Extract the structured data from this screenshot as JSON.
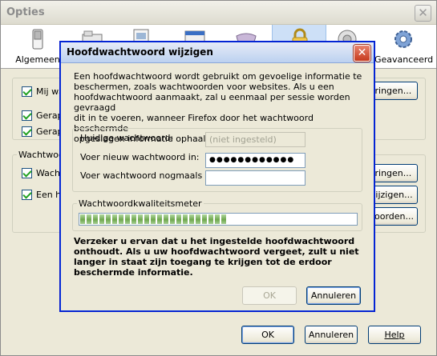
{
  "options_window": {
    "title": "Opties",
    "close_glyph": "✕",
    "toolbar": [
      {
        "label": "Algemeen",
        "icon": "switch-icon"
      },
      {
        "label": "",
        "icon": "tabs-icon"
      },
      {
        "label": "",
        "icon": "content-icon"
      },
      {
        "label": "",
        "icon": "feeds-icon"
      },
      {
        "label": "",
        "icon": "privacy-mask-icon"
      },
      {
        "label": "",
        "icon": "lock-icon"
      },
      {
        "label": "",
        "icon": "advanced-icon"
      },
      {
        "label": "Geavanceerd",
        "icon": "gear-icon"
      }
    ],
    "group1": {
      "items": [
        "Mij waa",
        "Gerapp",
        "Gerapp"
      ],
      "button": "eringen..."
    },
    "group2": {
      "title": "Wachtwoor",
      "items": [
        "Wachtu",
        "Een ho"
      ],
      "buttons": [
        "eringen...",
        "wijzigen...",
        "woorden..."
      ]
    },
    "footer": {
      "ok": "OK",
      "cancel": "Annuleren",
      "help": "Help"
    }
  },
  "dialog": {
    "title": "Hoofdwachtwoord wijzigen",
    "close_glyph": "✕",
    "intro_lines": [
      "Een hoofdwachtwoord wordt gebruikt om gevoelige informatie te",
      "beschermen, zoals wachtwoorden voor websites. Als u een",
      "hoofdwachtwoord aanmaakt, zal u eenmaal per sessie worden gevraagd",
      "dit in te voeren, wanneer Firefox door het wachtwoord beschermde",
      "opgeslagen informatie ophaalt."
    ],
    "fields": {
      "current_label": "Huidige wachtwoord:",
      "current_value": "(niet ingesteld)",
      "new_label": "Voer nieuw wachtwoord in:",
      "new_value": "●●●●●●●●●●●●",
      "confirm_label": "Voer wachtwoord nogmaals in:",
      "confirm_value": ""
    },
    "quality": {
      "title": "Wachtwoordkwaliteitsmeter",
      "level_fraction": 0.54,
      "color": "#6fa74e"
    },
    "warning_lines": [
      "Verzeker u ervan dat u het ingestelde hoofdwachtwoord",
      "onthoudt. Als u uw hoofdwachtwoord vergeet, zult u niet",
      "langer in staat zijn toegang te krijgen tot de erdoor",
      "beschermde informatie."
    ],
    "ok": "OK",
    "cancel": "Annuleren"
  }
}
